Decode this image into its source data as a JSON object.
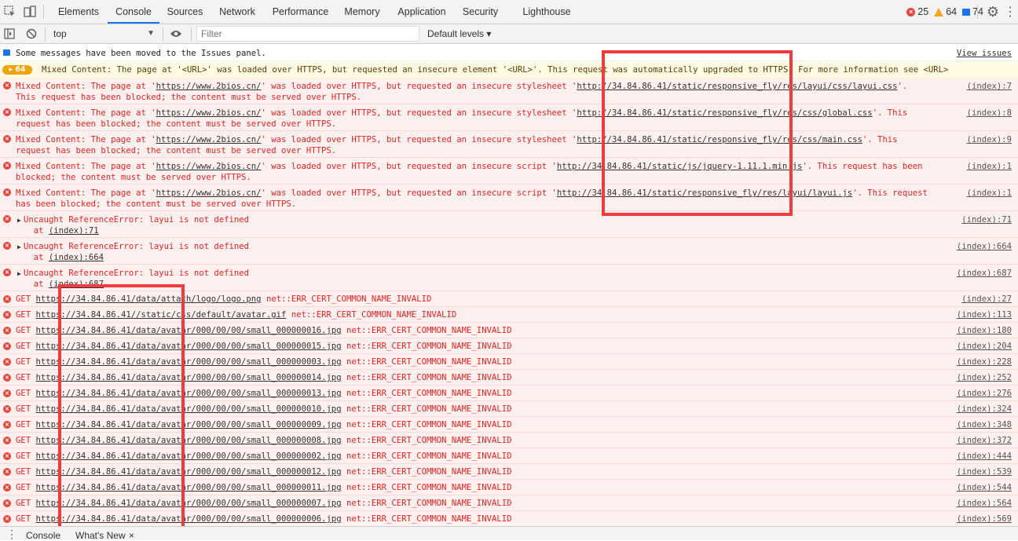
{
  "tabs": [
    {
      "label": "Elements"
    },
    {
      "label": "Console"
    },
    {
      "label": "Sources"
    },
    {
      "label": "Network"
    },
    {
      "label": "Performance"
    },
    {
      "label": "Memory"
    },
    {
      "label": "Application"
    },
    {
      "label": "Security"
    },
    {
      "label": "Lighthouse"
    }
  ],
  "counts": {
    "errors": "25",
    "warnings": "64",
    "info": "74"
  },
  "toolbar": {
    "context": "top",
    "filter_placeholder": "Filter",
    "levels": "Default levels ▾"
  },
  "info_banner": {
    "text": "Some messages have been moved to the Issues panel.",
    "link": "View issues"
  },
  "warning": {
    "count": "64",
    "text": "Mixed Content: The page at '<URL>' was loaded over HTTPS, but requested an insecure element '<URL>'. This request was automatically upgraded to HTTPS, For more information see <URL>"
  },
  "mixed": [
    {
      "a": "Mixed Content: The page at '",
      "page": "https://www.2bios.cn/",
      "b": "' was loaded over HTTPS, but requested an insecure stylesheet '",
      "res": "http://34.84.86.41/static/responsive_fly/res/layui/css/layui.css",
      "c": "'.\nThis request has been blocked; the content must be served over HTTPS.",
      "src": "(index):7"
    },
    {
      "a": "Mixed Content: The page at '",
      "page": "https://www.2bios.cn/",
      "b": "' was loaded over HTTPS, but requested an insecure stylesheet '",
      "res": "http://34.84.86.41/static/responsive_fly/res/css/global.css",
      "c": "'. This\nrequest has been blocked; the content must be served over HTTPS.",
      "src": "(index):8"
    },
    {
      "a": "Mixed Content: The page at '",
      "page": "https://www.2bios.cn/",
      "b": "' was loaded over HTTPS, but requested an insecure stylesheet '",
      "res": "http://34.84.86.41/static/responsive_fly/res/css/main.css",
      "c": "'. This\nrequest has been blocked; the content must be served over HTTPS.",
      "src": "(index):9"
    },
    {
      "a": "Mixed Content: The page at '",
      "page": "https://www.2bios.cn/",
      "b": "' was loaded over HTTPS, but requested an insecure script '",
      "res": "http://34.84.86.41/static/js/jquery-1.11.1.min.js",
      "c": "'. This request has been\nblocked; the content must be served over HTTPS.",
      "src": "(index):1"
    },
    {
      "a": "Mixed Content: The page at '",
      "page": "https://www.2bios.cn/",
      "b": "' was loaded over HTTPS, but requested an insecure script '",
      "res": "http://34.84.86.41/static/responsive_fly/res/layui/layui.js",
      "c": "'. This request\nhas been blocked; the content must be served over HTTPS.",
      "src": "(index):1"
    }
  ],
  "refs": [
    {
      "text": "Uncaught ReferenceError: layui is not defined",
      "at": "at ",
      "loc": "(index):71",
      "src": "(index):71"
    },
    {
      "text": "Uncaught ReferenceError: layui is not defined",
      "at": "at ",
      "loc": "(index):664",
      "src": "(index):664"
    },
    {
      "text": "Uncaught ReferenceError: layui is not defined",
      "at": "at ",
      "loc": "(index):687",
      "src": "(index):687"
    }
  ],
  "gets": [
    {
      "url": "https://34.84.86.41/data/attach/logo/logo.png",
      "err": "net::ERR_CERT_COMMON_NAME_INVALID",
      "src": "(index):27"
    },
    {
      "url": "https://34.84.86.41//static/css/default/avatar.gif",
      "err": "net::ERR_CERT_COMMON_NAME_INVALID",
      "src": "(index):113"
    },
    {
      "url": "https://34.84.86.41/data/avatar/000/00/00/small_000000016.jpg",
      "err": "net::ERR_CERT_COMMON_NAME_INVALID",
      "src": "(index):180"
    },
    {
      "url": "https://34.84.86.41/data/avatar/000/00/00/small_000000015.jpg",
      "err": "net::ERR_CERT_COMMON_NAME_INVALID",
      "src": "(index):204"
    },
    {
      "url": "https://34.84.86.41/data/avatar/000/00/00/small_000000003.jpg",
      "err": "net::ERR_CERT_COMMON_NAME_INVALID",
      "src": "(index):228"
    },
    {
      "url": "https://34.84.86.41/data/avatar/000/00/00/small_000000014.jpg",
      "err": "net::ERR_CERT_COMMON_NAME_INVALID",
      "src": "(index):252"
    },
    {
      "url": "https://34.84.86.41/data/avatar/000/00/00/small_000000013.jpg",
      "err": "net::ERR_CERT_COMMON_NAME_INVALID",
      "src": "(index):276"
    },
    {
      "url": "https://34.84.86.41/data/avatar/000/00/00/small_000000010.jpg",
      "err": "net::ERR_CERT_COMMON_NAME_INVALID",
      "src": "(index):324"
    },
    {
      "url": "https://34.84.86.41/data/avatar/000/00/00/small_000000009.jpg",
      "err": "net::ERR_CERT_COMMON_NAME_INVALID",
      "src": "(index):348"
    },
    {
      "url": "https://34.84.86.41/data/avatar/000/00/00/small_000000008.jpg",
      "err": "net::ERR_CERT_COMMON_NAME_INVALID",
      "src": "(index):372"
    },
    {
      "url": "https://34.84.86.41/data/avatar/000/00/00/small_000000002.jpg",
      "err": "net::ERR_CERT_COMMON_NAME_INVALID",
      "src": "(index):444"
    },
    {
      "url": "https://34.84.86.41/data/avatar/000/00/00/small_000000012.jpg",
      "err": "net::ERR_CERT_COMMON_NAME_INVALID",
      "src": "(index):539"
    },
    {
      "url": "https://34.84.86.41/data/avatar/000/00/00/small_000000011.jpg",
      "err": "net::ERR_CERT_COMMON_NAME_INVALID",
      "src": "(index):544"
    },
    {
      "url": "https://34.84.86.41/data/avatar/000/00/00/small_000000007.jpg",
      "err": "net::ERR_CERT_COMMON_NAME_INVALID",
      "src": "(index):564"
    },
    {
      "url": "https://34.84.86.41/data/avatar/000/00/00/small_000000006.jpg",
      "err": "net::ERR_CERT_COMMON_NAME_INVALID",
      "src": "(index):569"
    }
  ],
  "get_verb": "GET",
  "drawer": {
    "tab1": "Console",
    "tab2": "What's New",
    "close": "×"
  },
  "colors": {
    "error_text": "#e22222",
    "error_bg": "#fff0f0",
    "highlight_box": "#f03c3c",
    "accent": "#1a73e8"
  }
}
